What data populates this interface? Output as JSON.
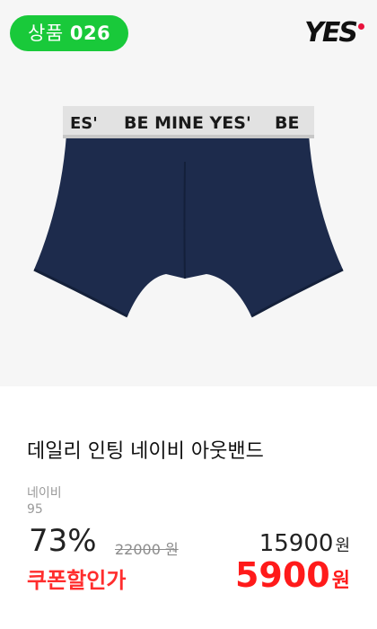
{
  "badge": {
    "prefix": "상품",
    "number": "026"
  },
  "brand": {
    "logo_text": "YES",
    "dot_color": "#e8123c"
  },
  "product_image": {
    "waistband_text": "BE MINE YES'",
    "waistband_left_fragment": "ES'",
    "waistband_right_fragment": "BE"
  },
  "product": {
    "title": "데일리 인팅 네이비 아웃밴드",
    "color": "네이비",
    "size": "95"
  },
  "pricing": {
    "discount": "73%",
    "original_price": "22000 원",
    "sale_price": "15900",
    "sale_currency": "원",
    "coupon_label": "쿠폰할인가",
    "final_price": "5900",
    "final_currency": "원"
  },
  "colors": {
    "badge_bg": "#19c93a",
    "accent_red": "#ff1a1a",
    "navy": "#1d2b4c"
  }
}
